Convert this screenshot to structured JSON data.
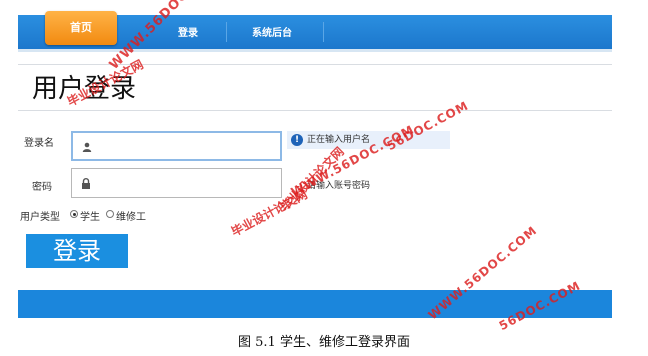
{
  "nav": {
    "home": "首页",
    "login": "登录",
    "admin": "系统后台"
  },
  "page": {
    "title": "用户登录"
  },
  "form": {
    "username_label": "登录名",
    "password_label": "密码",
    "username_hint": "正在输入用户名",
    "password_hint": "请输入账号密码",
    "user_type_label": "用户类型",
    "options": [
      "学生",
      "维修工"
    ],
    "selected_option": "学生",
    "submit_label": "登录"
  },
  "caption": "图 5.1 学生、维修工登录界面",
  "watermark": {
    "cn": "毕业设计论文网",
    "url": "WWW.56DOC.COM",
    "url_short": "56DOC.COM",
    "color": "#dc1e1e"
  },
  "colors": {
    "nav_blue": "#1c77cc",
    "home_orange": "#f28a10",
    "button_blue": "#1b8fe0"
  }
}
